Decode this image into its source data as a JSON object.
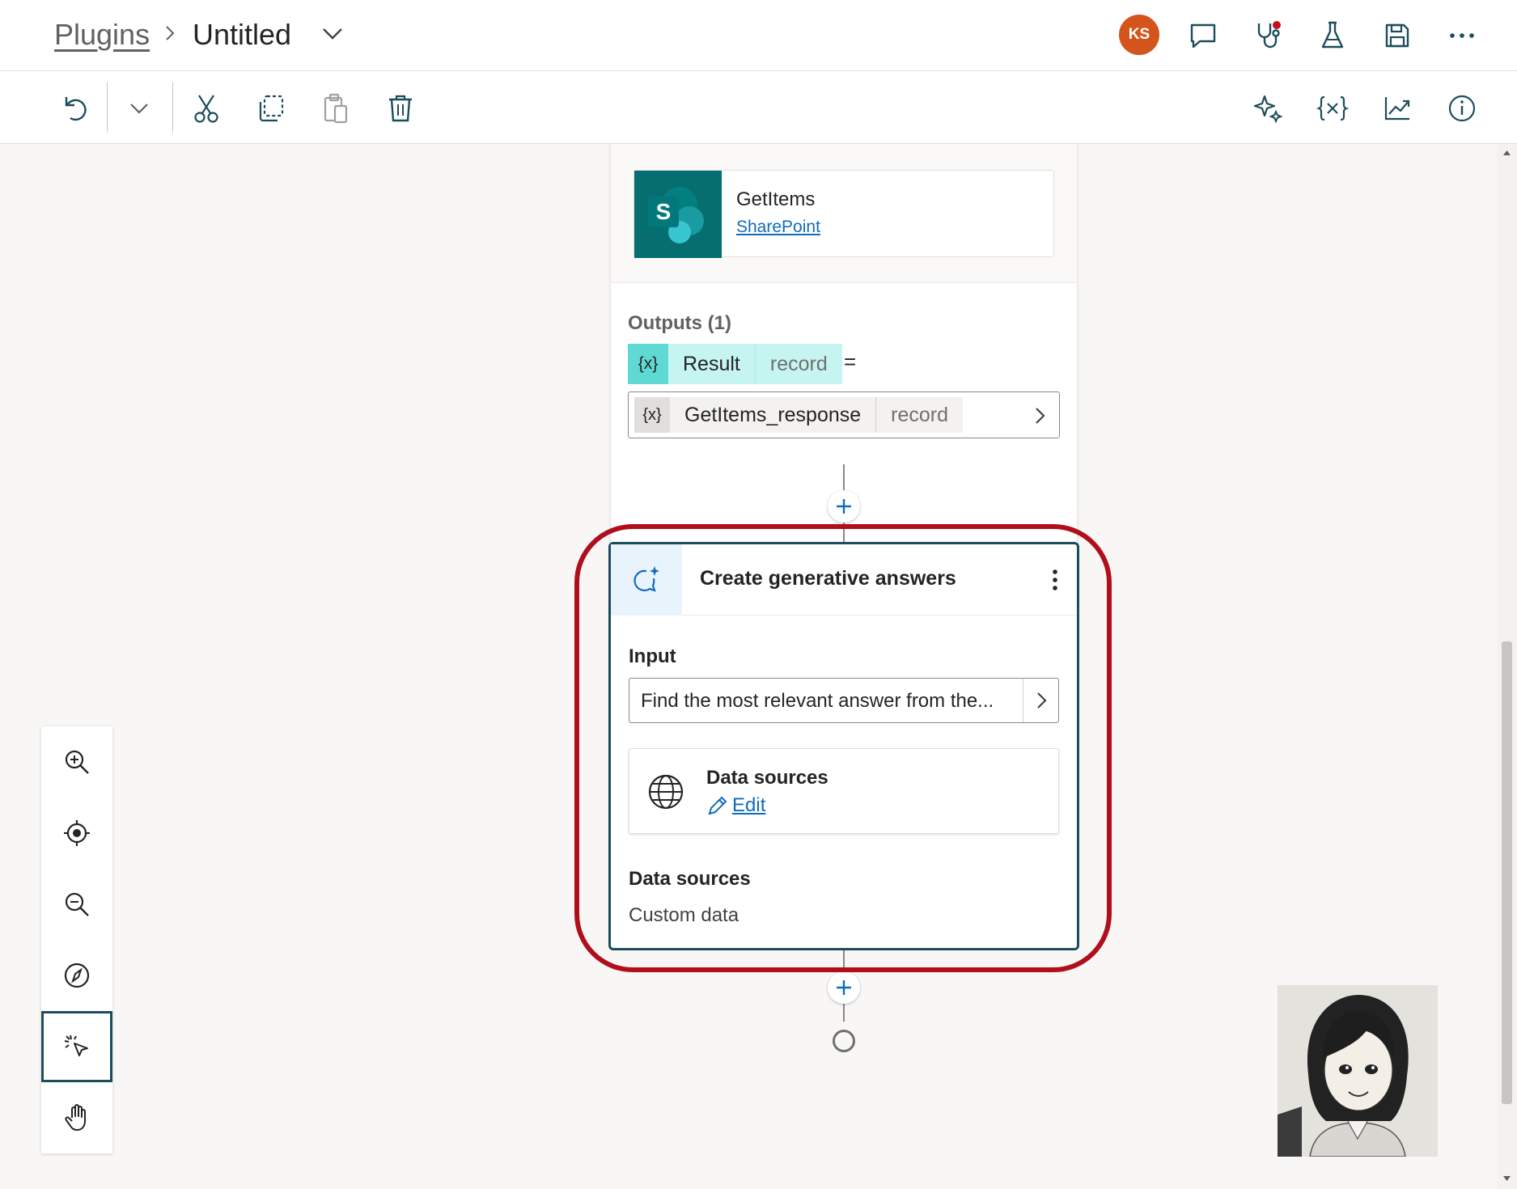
{
  "header": {
    "breadcrumb_root": "Plugins",
    "title": "Untitled",
    "avatar_initials": "KS"
  },
  "action_card": {
    "action_name": "GetItems",
    "connector_link": "SharePoint",
    "logo_letter": "S",
    "outputs_label": "Outputs (1)",
    "output_var": {
      "icon": "{x}",
      "name": "Result",
      "type": "record"
    },
    "equals": "=",
    "value": {
      "icon": "{x}",
      "name": "GetItems_response",
      "type": "record"
    }
  },
  "generative_card": {
    "title": "Create generative answers",
    "input_label": "Input",
    "input_value": "Find the most relevant answer from the...",
    "data_sources_title": "Data sources",
    "edit_link": "Edit",
    "data_sources_label": "Data sources",
    "data_sources_value": "Custom data"
  },
  "colors": {
    "highlight": "#b10e1c",
    "accent": "#1b4d5c",
    "sharepoint": "#066e6e",
    "variable": "#5fd9d3"
  },
  "icons": {
    "topbar": [
      "comment-icon",
      "stethoscope-icon",
      "beaker-icon",
      "save-icon",
      "more-icon"
    ],
    "toolbar": [
      "undo-icon",
      "chevron-down-icon",
      "cut-icon",
      "copy-icon",
      "paste-icon",
      "delete-icon",
      "sparkle-icon",
      "variable-icon",
      "analytics-icon",
      "info-icon"
    ],
    "zoom_panel": [
      "zoom-in-icon",
      "center-icon",
      "zoom-out-icon",
      "minimap-icon",
      "select-icon",
      "pan-icon"
    ]
  }
}
